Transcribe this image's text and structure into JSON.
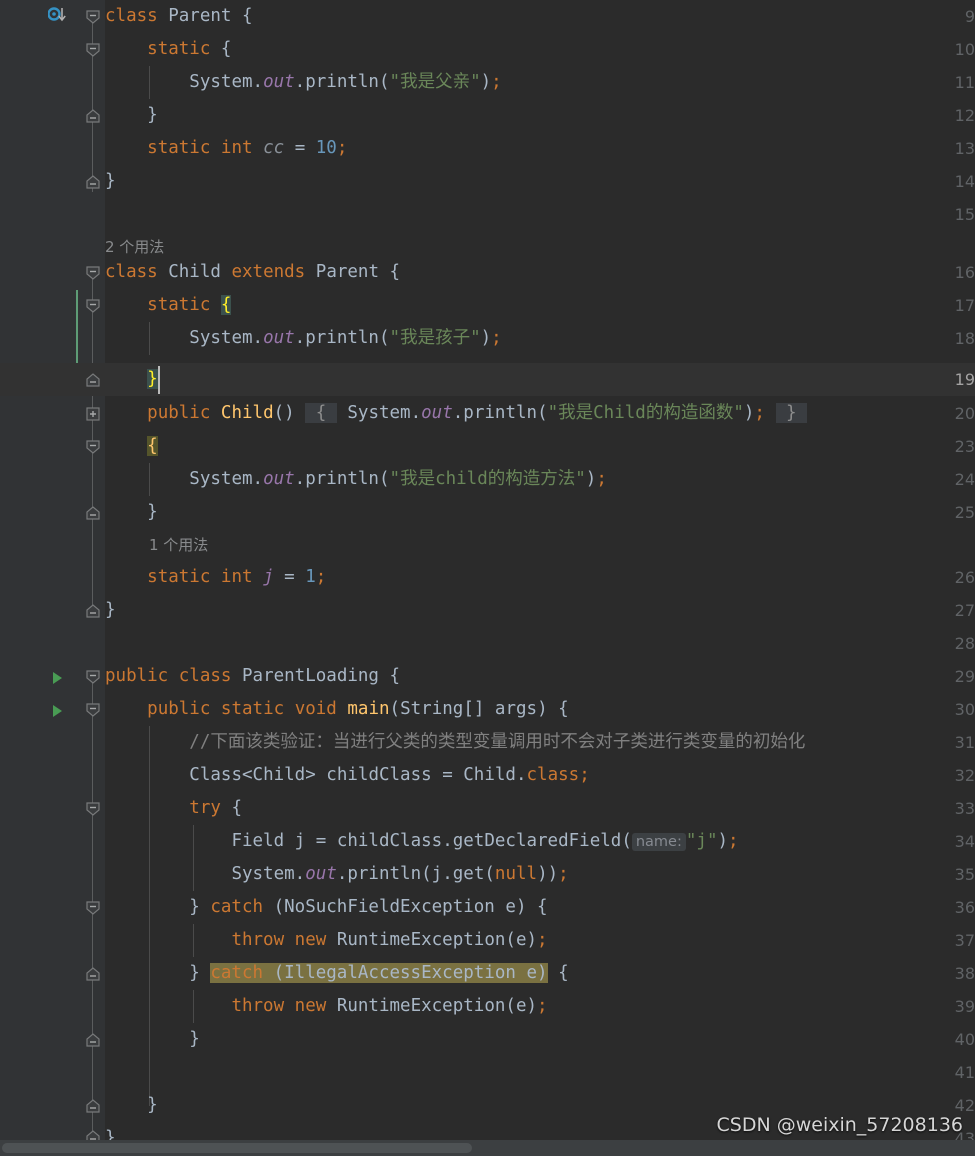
{
  "app": {
    "name": "IntelliJ IDEA Editor",
    "theme": "Darcula",
    "language": "Java"
  },
  "colors": {
    "editor_background": "#2B2B2B",
    "gutter_background": "#313335",
    "caret_row_background": "#323232",
    "keyword": "#CC7832",
    "string": "#6A8759",
    "number": "#6897BB",
    "comment": "#808080",
    "default_text": "#A9B7C6",
    "static_field": "#9876AA",
    "line_number": "#606366",
    "current_line_number": "#A4A3A3",
    "identifier_highlight": "#7A7141",
    "brace_match_highlight": "#3B514D",
    "folded_region": "#3A3D41",
    "inlay_hint": "#868A91",
    "vcs_modified_marker": "#5E9C76",
    "run_gutter_icon": "#499C54",
    "implemented_gutter_icon": "#3592C4",
    "scrollbar": "#4E5254"
  },
  "watermark": "CSDN @weixin_57208136",
  "inlay_hints": {
    "usages_parent": "2 个用法",
    "usages_j_field": "1 个用法",
    "param_name": "name:"
  },
  "lines": [
    {
      "number": "9",
      "text": "class Parent {"
    },
    {
      "number": "10",
      "text": "    static {"
    },
    {
      "number": "11",
      "text": "        System.out.println(\"我是父亲\");"
    },
    {
      "number": "12",
      "text": "    }"
    },
    {
      "number": "13",
      "text": "    static int cc = 10;"
    },
    {
      "number": "14",
      "text": "}"
    },
    {
      "number": "15",
      "text": ""
    },
    {
      "number": "16",
      "text": "class Child extends Parent {"
    },
    {
      "number": "17",
      "text": "    static {"
    },
    {
      "number": "18",
      "text": "        System.out.println(\"我是孩子\");"
    },
    {
      "number": "19",
      "text": "    }"
    },
    {
      "number": "20",
      "text": "    public Child() { System.out.println(\"我是Child的构造函数\"); }"
    },
    {
      "number": "23",
      "text": "    {"
    },
    {
      "number": "24",
      "text": "        System.out.println(\"我是child的构造方法\");"
    },
    {
      "number": "25",
      "text": "    }"
    },
    {
      "number": "26",
      "text": "    static int j = 1;"
    },
    {
      "number": "27",
      "text": "}"
    },
    {
      "number": "28",
      "text": ""
    },
    {
      "number": "29",
      "text": "public class ParentLoading {"
    },
    {
      "number": "30",
      "text": "    public static void main(String[] args) {"
    },
    {
      "number": "31",
      "text": "        //下面该类验证：当进行父类的类型变量调用时不会对子类进行类变量的初始化"
    },
    {
      "number": "32",
      "text": "        Class<Child> childClass = Child.class;"
    },
    {
      "number": "33",
      "text": "        try {"
    },
    {
      "number": "34",
      "text": "            Field j = childClass.getDeclaredField( name: \"j\");"
    },
    {
      "number": "35",
      "text": "            System.out.println(j.get(null));"
    },
    {
      "number": "36",
      "text": "        } catch (NoSuchFieldException e) {"
    },
    {
      "number": "37",
      "text": "            throw new RuntimeException(e);"
    },
    {
      "number": "38",
      "text": "        } catch (IllegalAccessException e) {"
    },
    {
      "number": "39",
      "text": "            throw new RuntimeException(e);"
    },
    {
      "number": "40",
      "text": "        }"
    },
    {
      "number": "41",
      "text": ""
    },
    {
      "number": "42",
      "text": "    }"
    },
    {
      "number": "43",
      "text": "}"
    }
  ],
  "tokens": {
    "kw_class": "class",
    "kw_static": "static",
    "kw_int": "int",
    "kw_extends": "extends",
    "kw_public": "public",
    "kw_void": "void",
    "kw_try": "try",
    "kw_catch": "catch",
    "kw_throw": "throw",
    "kw_new": "new",
    "kw_null": "null",
    "kw_class_literal": "class",
    "id_Parent": "Parent",
    "id_Child": "Child",
    "id_ParentLoading": "ParentLoading",
    "id_System": "System",
    "id_out": "out",
    "id_println": "println",
    "id_cc": "cc",
    "id_j": "j",
    "id_main": "main",
    "id_String": "String",
    "id_args": "args",
    "id_Class": "Class",
    "id_childClass": "childClass",
    "id_Field": "Field",
    "id_getDeclaredField": "getDeclaredField",
    "id_get": "get",
    "id_NoSuchFieldException": "NoSuchFieldException",
    "id_IllegalAccessException": "IllegalAccessException",
    "id_RuntimeException": "RuntimeException",
    "id_e": "e",
    "num_10": "10",
    "num_1": "1",
    "str_father": "\"我是父亲\"",
    "str_child": "\"我是孩子\"",
    "str_child_ctor": "\"我是Child的构造函数\"",
    "str_child_method": "\"我是child的构造方法\"",
    "str_j": "\"j\"",
    "comment_31": "//下面该类验证：当进行父类的类型变量调用时不会对子类进行类变量的初始化"
  },
  "gutter_icons": {
    "line9": "implemented-by-subclass-icon",
    "line29": "run-class-icon",
    "line30": "run-method-icon"
  }
}
